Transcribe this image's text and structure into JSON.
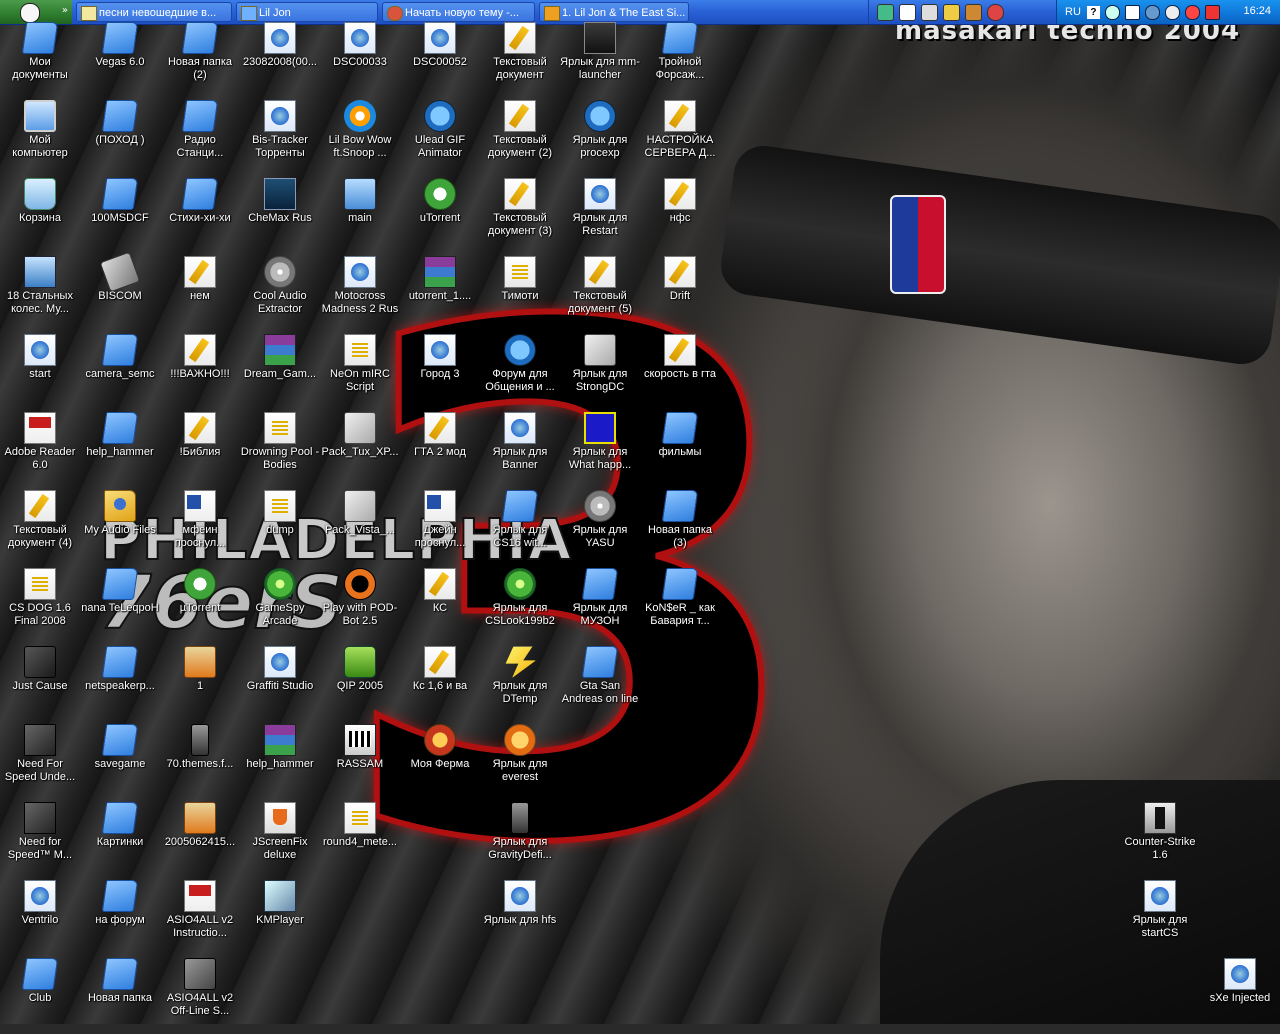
{
  "wallpaper": {
    "brand_text": "masakari techno 2004",
    "big_number": "3",
    "team_city": "PHILADELPHIA",
    "team_name": "76erS",
    "badge_text": "NBA"
  },
  "taskbar": {
    "tasks": [
      {
        "label": "песни невошедшие в..."
      },
      {
        "label": "Lil Jon"
      },
      {
        "label": "Начать новую тему -..."
      },
      {
        "label": "1. Lil Jon & The East Si..."
      }
    ],
    "tray": {
      "language": "RU",
      "help": "?",
      "clock": "16:24"
    }
  },
  "desktop": {
    "icons": [
      {
        "label": "Мои документы",
        "icon": "folder-icon"
      },
      {
        "label": "Мой компьютер",
        "icon": "computer-icon"
      },
      {
        "label": "Корзина",
        "icon": "recycle-bin-icon"
      },
      {
        "label": "18 Стальных колес. Му...",
        "icon": "truck-icon"
      },
      {
        "label": "start",
        "icon": "shortcut-icon"
      },
      {
        "label": "Adobe Reader 6.0",
        "icon": "pdf-icon"
      },
      {
        "label": "Текстовый документ (4)",
        "icon": "text-document-icon"
      },
      {
        "label": "CS DOG 1.6 Final 2008",
        "icon": "document-icon"
      },
      {
        "label": "Just Cause",
        "icon": "game-icon"
      },
      {
        "label": "Need For Speed Unde...",
        "icon": "nfs-icon"
      },
      {
        "label": "Need for Speed™ M...",
        "icon": "nfs-mw-icon"
      },
      {
        "label": "Ventrilo",
        "icon": "shortcut-icon"
      },
      {
        "label": "Club",
        "icon": "folder-icon"
      },
      {
        "label": "Vegas 6.0",
        "icon": "folder-icon"
      },
      {
        "label": "(ПОХОД )",
        "icon": "folder-icon"
      },
      {
        "label": "100MSDCF",
        "icon": "folder-icon"
      },
      {
        "label": "BISCOM",
        "icon": "bios-icon"
      },
      {
        "label": "camera_semc",
        "icon": "folder-icon"
      },
      {
        "label": "help_hammer",
        "icon": "folder-icon"
      },
      {
        "label": "My Audio Files",
        "icon": "audio-folder-icon"
      },
      {
        "label": "nana TeLeqpoH",
        "icon": "folder-icon"
      },
      {
        "label": "netspeakerp...",
        "icon": "folder-icon"
      },
      {
        "label": "savegame",
        "icon": "folder-icon"
      },
      {
        "label": "Картинки",
        "icon": "folder-icon"
      },
      {
        "label": "на форум",
        "icon": "folder-icon"
      },
      {
        "label": "Новая папка",
        "icon": "folder-icon"
      },
      {
        "label": "Новая папка (2)",
        "icon": "folder-icon"
      },
      {
        "label": "Радио Станци...",
        "icon": "folder-icon"
      },
      {
        "label": "Стихи-хи-хи",
        "icon": "folder-icon"
      },
      {
        "label": "нем",
        "icon": "text-document-icon"
      },
      {
        "label": "!!!ВАЖНО!!!",
        "icon": "text-document-icon"
      },
      {
        "label": "!Библия",
        "icon": "text-document-icon"
      },
      {
        "label": "мфеин проснул...",
        "icon": "word-document-icon"
      },
      {
        "label": "µTorrent",
        "icon": "utorrent-icon"
      },
      {
        "label": "1",
        "icon": "gif-icon"
      },
      {
        "label": "70.themes.f...",
        "icon": "phone-icon"
      },
      {
        "label": "2005062415...",
        "icon": "gif-icon"
      },
      {
        "label": "ASIO4ALL v2 Instructio...",
        "icon": "pdf-icon"
      },
      {
        "label": "ASIO4ALL v2 Off-Line S...",
        "icon": "iso-icon"
      },
      {
        "label": "23082008(00...",
        "icon": "shortcut-icon"
      },
      {
        "label": "Bis-Tracker Торренты",
        "icon": "shortcut-icon"
      },
      {
        "label": "CheMax Rus",
        "icon": "chemax-icon"
      },
      {
        "label": "Cool Audio Extractor",
        "icon": "cd-icon"
      },
      {
        "label": "Dream_Gam...",
        "icon": "winrar-icon"
      },
      {
        "label": "Drowning Pool - Bodies",
        "icon": "media-icon"
      },
      {
        "label": "dump",
        "icon": "document-icon"
      },
      {
        "label": "GameSpy Arcade",
        "icon": "green-orb-icon"
      },
      {
        "label": "Graffiti Studio",
        "icon": "shortcut-icon"
      },
      {
        "label": "help_hammer",
        "icon": "winrar-icon"
      },
      {
        "label": "JScreenFix deluxe",
        "icon": "java-icon"
      },
      {
        "label": "KMPlayer",
        "icon": "kmplayer-icon"
      },
      {
        "label": "DSC00033",
        "icon": "shortcut-icon"
      },
      {
        "label": "Lil Bow Wow ft.Snoop ...",
        "icon": "msn-icon"
      },
      {
        "label": "main",
        "icon": "tool-icon"
      },
      {
        "label": "Motocross Madness 2 Rus",
        "icon": "shortcut-icon"
      },
      {
        "label": "NeOn mIRC Script",
        "icon": "document-icon"
      },
      {
        "label": "Pack_Tux_XP...",
        "icon": "exe-icon"
      },
      {
        "label": "Pack_Vista_...",
        "icon": "exe-icon"
      },
      {
        "label": "Play with POD-Bot 2.5",
        "icon": "half-life-icon"
      },
      {
        "label": "QIP 2005",
        "icon": "qip-icon"
      },
      {
        "label": "RASSAM",
        "icon": "rassam-icon"
      },
      {
        "label": "round4_mete...",
        "icon": "media-icon"
      },
      {
        "label": "DSC00052",
        "icon": "shortcut-icon"
      },
      {
        "label": "Ulead GIF Animator",
        "icon": "globe-icon"
      },
      {
        "label": "uTorrent",
        "icon": "utorrent-icon"
      },
      {
        "label": "utorrent_1....",
        "icon": "winrar-icon"
      },
      {
        "label": "Город 3",
        "icon": "shortcut-icon"
      },
      {
        "label": "ГТА 2 мод",
        "icon": "text-document-icon"
      },
      {
        "label": "Джейн проснул...",
        "icon": "word-document-icon"
      },
      {
        "label": "КС",
        "icon": "text-document-icon"
      },
      {
        "label": "Кс 1,6 и ва",
        "icon": "text-document-icon"
      },
      {
        "label": "Моя Ферма",
        "icon": "rooster-icon"
      },
      {
        "label": "Текстовый документ",
        "icon": "text-document-icon"
      },
      {
        "label": "Текстовый документ (2)",
        "icon": "text-document-icon"
      },
      {
        "label": "Текстовый документ (3)",
        "icon": "text-document-icon"
      },
      {
        "label": "Тимоти",
        "icon": "media-icon"
      },
      {
        "label": "Форум для Общения и ...",
        "icon": "globe-icon"
      },
      {
        "label": "Ярлык для Banner",
        "icon": "shortcut-icon"
      },
      {
        "label": "Ярлык для CS16 wit...",
        "icon": "folder-icon"
      },
      {
        "label": "Ярлык для CSLook199b2",
        "icon": "green-orb-icon"
      },
      {
        "label": "Ярлык для DTemp",
        "icon": "bolt-icon"
      },
      {
        "label": "Ярлык для everest",
        "icon": "info-icon"
      },
      {
        "label": "Ярлык для GravityDefi...",
        "icon": "phone-icon"
      },
      {
        "label": "Ярлык для hfs",
        "icon": "shortcut-icon"
      },
      {
        "label": "Ярлык для mm-launcher",
        "icon": "mafia-icon"
      },
      {
        "label": "Ярлык для procexp",
        "icon": "windows-icon"
      },
      {
        "label": "Ярлык для Restart",
        "icon": "shortcut-icon"
      },
      {
        "label": "Текстовый документ (5)",
        "icon": "text-document-icon"
      },
      {
        "label": "Ярлык для StrongDC",
        "icon": "exe-icon"
      },
      {
        "label": "Ярлык для What happ...",
        "icon": "flo-icon"
      },
      {
        "label": "Ярлык для YASU",
        "icon": "cd-icon"
      },
      {
        "label": "Ярлык для МУЗОН",
        "icon": "folder-icon"
      },
      {
        "label": "Gta San Andreas on line",
        "icon": "folder-icon"
      },
      {
        "label": "Тройной Форсаж...",
        "icon": "folder-icon"
      },
      {
        "label": "НАСТРОЙКА СЕРВЕРА Д...",
        "icon": "text-document-icon"
      },
      {
        "label": "нфс",
        "icon": "text-document-icon"
      },
      {
        "label": "Drift",
        "icon": "text-document-icon"
      },
      {
        "label": "скорость в гта",
        "icon": "text-document-icon"
      },
      {
        "label": "фильмы",
        "icon": "folder-icon"
      },
      {
        "label": "Новая папка (3)",
        "icon": "folder-icon"
      },
      {
        "label": "KoN$eR _ как Бавария т...",
        "icon": "folder-icon"
      },
      {
        "label": "Counter-Strike 1.6",
        "icon": "counter-strike-icon"
      },
      {
        "label": "Ярлык для startCS",
        "icon": "shortcut-icon"
      },
      {
        "label": "sXe Injected",
        "icon": "shortcut-icon"
      }
    ]
  }
}
